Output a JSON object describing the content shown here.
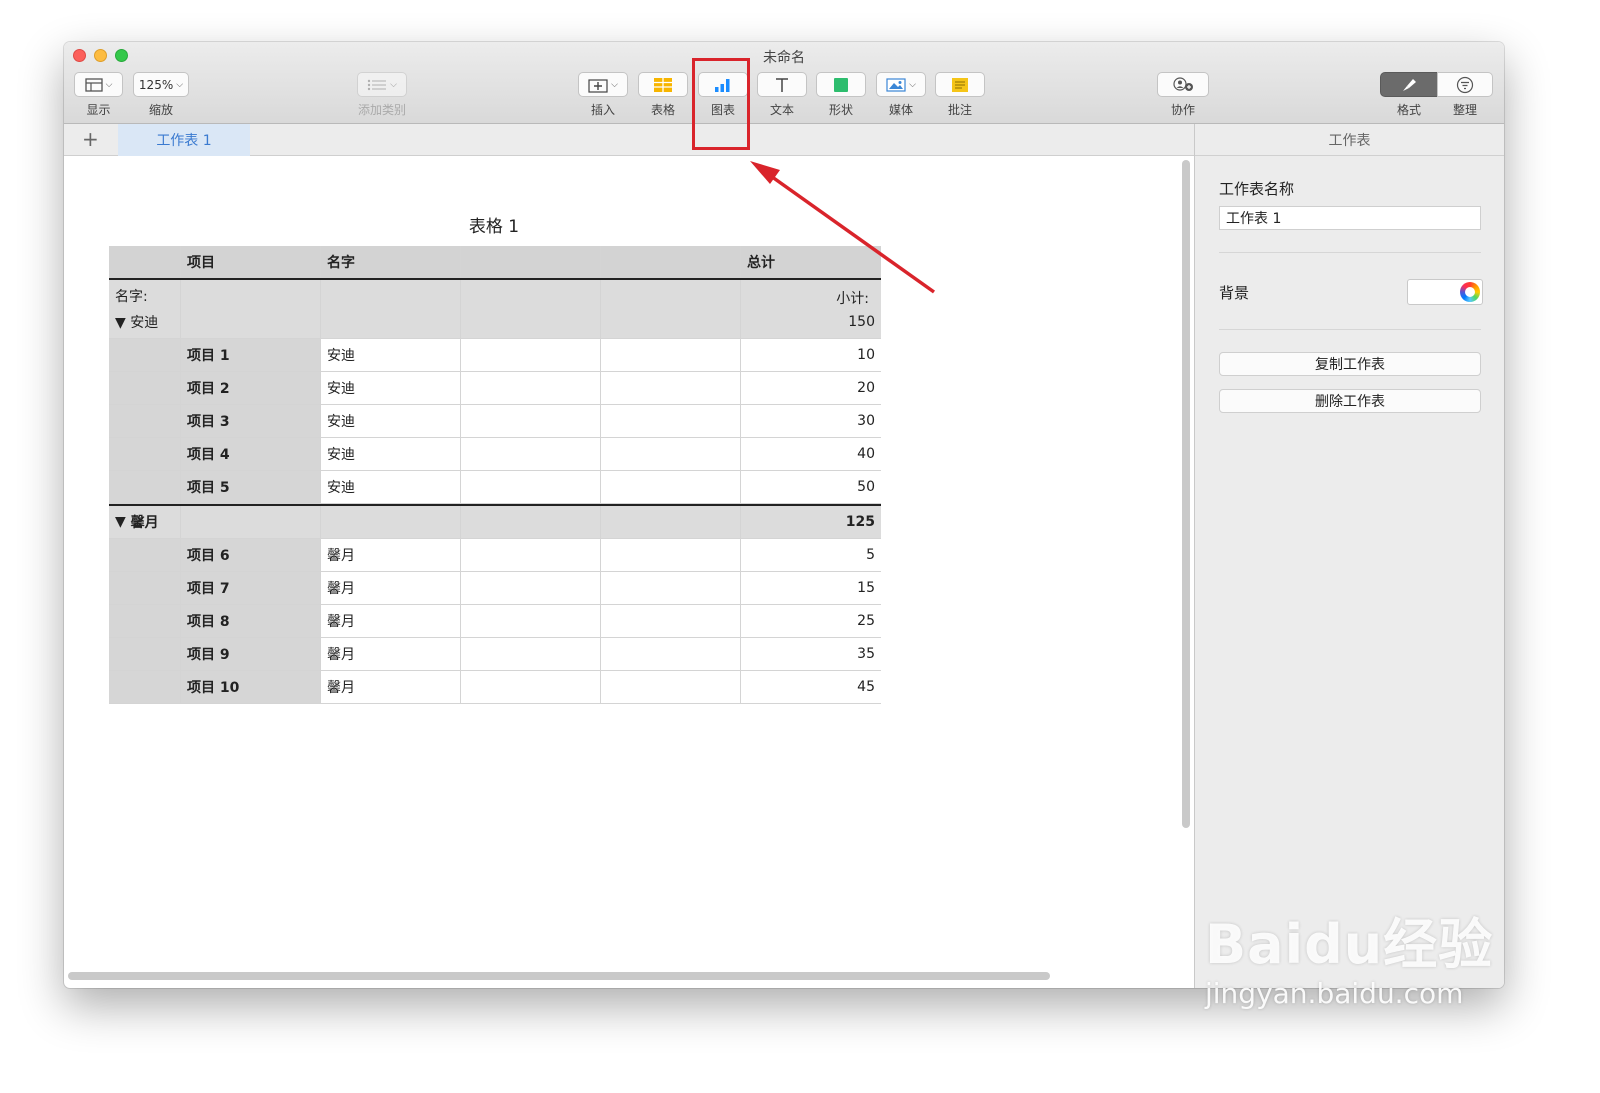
{
  "window": {
    "title": "未命名"
  },
  "toolbar": {
    "view_label": "显示",
    "zoom_value": "125%",
    "zoom_label": "缩放",
    "add_category_label": "添加类别",
    "insert_label": "插入",
    "table_label": "表格",
    "chart_label": "图表",
    "text_label": "文本",
    "shape_label": "形状",
    "media_label": "媒体",
    "comment_label": "批注",
    "collaborate_label": "协作",
    "format_label": "格式",
    "organize_label": "整理"
  },
  "tabs": {
    "add": "+",
    "active_sheet": "工作表 1"
  },
  "table": {
    "title": "表格 1",
    "header": [
      "",
      "项目",
      "名字",
      "",
      "",
      "总计"
    ],
    "groups": [
      {
        "label_name": "名字:",
        "name": "安迪",
        "subtotal_label": "小计:",
        "subtotal": "150",
        "rows": [
          {
            "item": "项目 1",
            "name": "安迪",
            "total": "10"
          },
          {
            "item": "项目 2",
            "name": "安迪",
            "total": "20"
          },
          {
            "item": "项目 3",
            "name": "安迪",
            "total": "30"
          },
          {
            "item": "项目 4",
            "name": "安迪",
            "total": "40"
          },
          {
            "item": "项目 5",
            "name": "安迪",
            "total": "50"
          }
        ]
      },
      {
        "name": "馨月",
        "subtotal": "125",
        "rows": [
          {
            "item": "项目 6",
            "name": "馨月",
            "total": "5"
          },
          {
            "item": "项目 7",
            "name": "馨月",
            "total": "15"
          },
          {
            "item": "项目 8",
            "name": "馨月",
            "total": "25"
          },
          {
            "item": "项目 9",
            "name": "馨月",
            "total": "35"
          },
          {
            "item": "项目 10",
            "name": "馨月",
            "total": "45"
          }
        ]
      }
    ]
  },
  "inspector": {
    "header": "工作表",
    "sheet_name_label": "工作表名称",
    "sheet_name_value": "工作表 1",
    "background_label": "背景",
    "duplicate_button": "复制工作表",
    "delete_button": "删除工作表"
  },
  "watermark": {
    "brand": "Baidu经验",
    "url": "jingyan.baidu.com"
  },
  "colors": {
    "highlight": "#d9242b",
    "tab_active": "#3a7ad0",
    "chart_icon": "#1a8cff"
  }
}
